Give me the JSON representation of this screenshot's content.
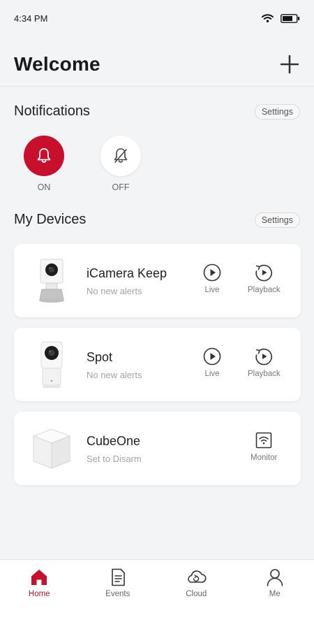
{
  "status_bar": {
    "time": "4:34 PM"
  },
  "header": {
    "title": "Welcome"
  },
  "notifications": {
    "title": "Notifications",
    "settings_label": "Settings",
    "on_label": "ON",
    "off_label": "OFF",
    "accent": "#c8102e"
  },
  "devices": {
    "title": "My Devices",
    "settings_label": "Settings",
    "items": [
      {
        "name": "iCamera Keep",
        "status": "No new alerts",
        "action1": "Live",
        "action2": "Playback"
      },
      {
        "name": "Spot",
        "status": "No new alerts",
        "action1": "Live",
        "action2": "Playback"
      },
      {
        "name": "CubeOne",
        "status": "Set to Disarm",
        "action1": "Monitor"
      }
    ]
  },
  "nav": {
    "home": "Home",
    "events": "Events",
    "cloud": "Cloud",
    "me": "Me"
  }
}
